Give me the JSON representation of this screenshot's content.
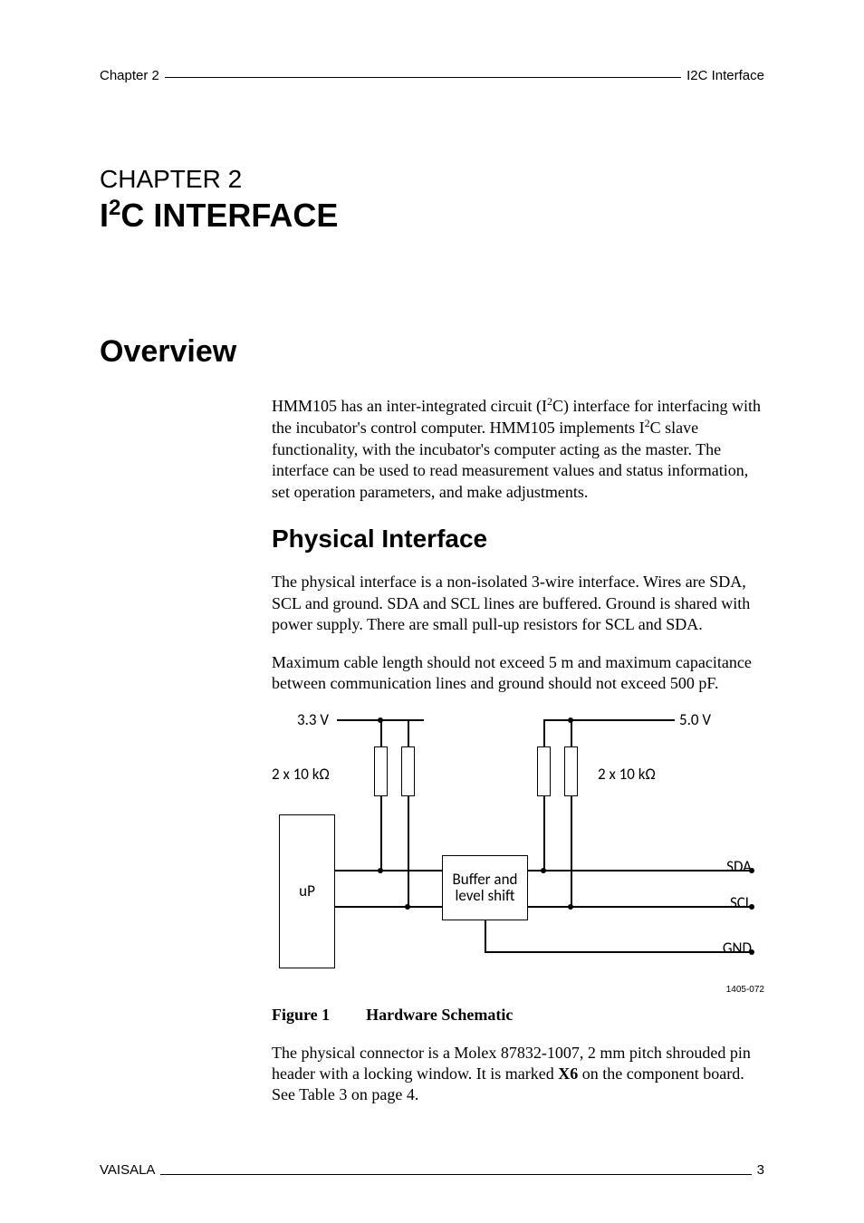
{
  "header": {
    "left": "Chapter 2",
    "right": "I2C Interface"
  },
  "chapter": {
    "label": "CHAPTER 2",
    "title_prefix": "I",
    "title_super": "2",
    "title_rest": "C INTERFACE"
  },
  "section_overview": {
    "heading": "Overview",
    "p1_a": "HMM105 has an inter-integrated circuit (I",
    "p1_b": "C) interface for interfacing with the incubator's control computer. HMM105 implements I",
    "p1_c": "C slave functionality, with the incubator's computer acting as the master. The interface can be used to read measurement values and status information, set operation parameters, and make adjustments."
  },
  "section_physical": {
    "heading": "Physical Interface",
    "p1": "The physical interface is a non-isolated 3-wire interface. Wires are SDA, SCL and ground.  SDA and SCL lines are buffered. Ground is shared with power supply. There are small pull-up resistors for SCL and SDA.",
    "p2": "Maximum cable length should not exceed 5 m and maximum capacitance between communication lines and ground should not exceed 500 pF.",
    "p3_a": "The physical connector is a Molex 87832-1007, 2 mm pitch shrouded pin header with a locking window. It is marked ",
    "p3_bold": "X6",
    "p3_b": " on the component board. See Table 3 on page 4."
  },
  "diagram": {
    "v33": "3.3 V",
    "v50": "5.0 V",
    "r_left": "2 x 10 kΩ",
    "r_right": "2 x 10 kΩ",
    "up": "uP",
    "buffer_l1": "Buffer and",
    "buffer_l2": "level shift",
    "sda": "SDA",
    "scl": "SCL",
    "gnd": "GND",
    "fig_id": "1405-072"
  },
  "figure": {
    "label": "Figure 1",
    "caption": "Hardware Schematic"
  },
  "footer": {
    "left": "VAISALA",
    "right": "3"
  }
}
